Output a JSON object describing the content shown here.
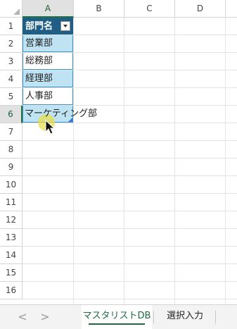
{
  "columns": [
    "A",
    "B",
    "C",
    "D"
  ],
  "rows": [
    "1",
    "2",
    "3",
    "4",
    "5",
    "6",
    "7",
    "8",
    "9",
    "10",
    "11",
    "12",
    "13",
    "14",
    "15",
    "16"
  ],
  "table": {
    "header": "部門名",
    "cells": [
      "営業部",
      "総務部",
      "経理部",
      "人事部",
      "マーケティング部"
    ]
  },
  "tabs": {
    "prev": "<",
    "next": ">",
    "sheets": [
      "マスタリストDB",
      "選択入力"
    ],
    "active": "マスタリストDB"
  },
  "colors": {
    "table_header": "#1f5f86",
    "table_band": "#bfe3f3",
    "table_border": "#3d93c8",
    "selection_accent": "#217346",
    "cursor_highlight": "#ecde46"
  },
  "icons": [
    "filter-dropdown-icon",
    "mouse-pointer-icon",
    "table-resize-handle-icon",
    "select-all-icon"
  ]
}
